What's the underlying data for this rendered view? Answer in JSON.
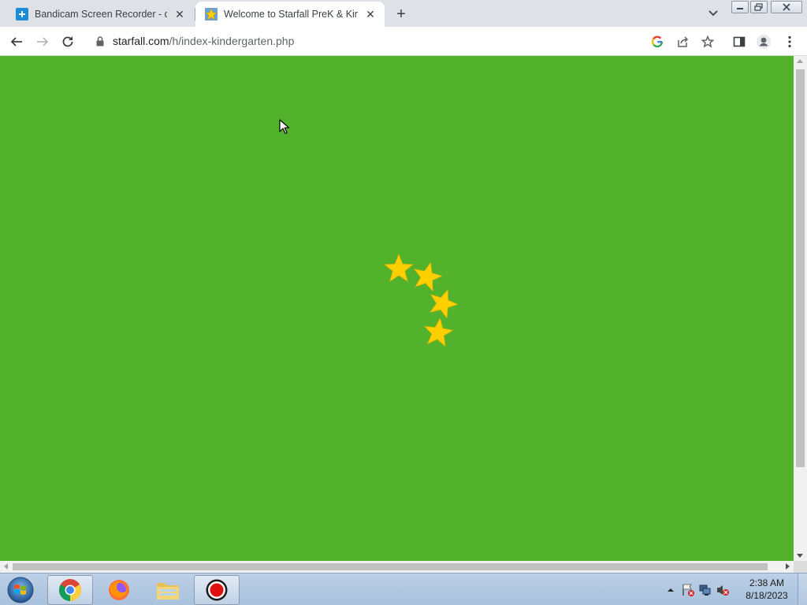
{
  "browser": {
    "tabs": [
      {
        "title": "Bandicam Screen Recorder - dow",
        "favicon": "bandicam-icon",
        "active": false
      },
      {
        "title": "Welcome to Starfall PreK & Kind",
        "favicon": "starfall-star-icon",
        "active": true
      }
    ],
    "address": {
      "host": "starfall.com",
      "path": "/h/index-kindergarten.php"
    }
  },
  "page": {
    "background_color": "#52b22c",
    "star_color": "#ffd000",
    "stars": [
      "star",
      "star",
      "star",
      "star"
    ]
  },
  "taskbar": {
    "apps": [
      "chrome-icon",
      "firefox-icon",
      "file-explorer-icon",
      "bandicam-record-icon"
    ],
    "clock": {
      "time": "2:38 AM",
      "date": "8/18/2023"
    }
  }
}
